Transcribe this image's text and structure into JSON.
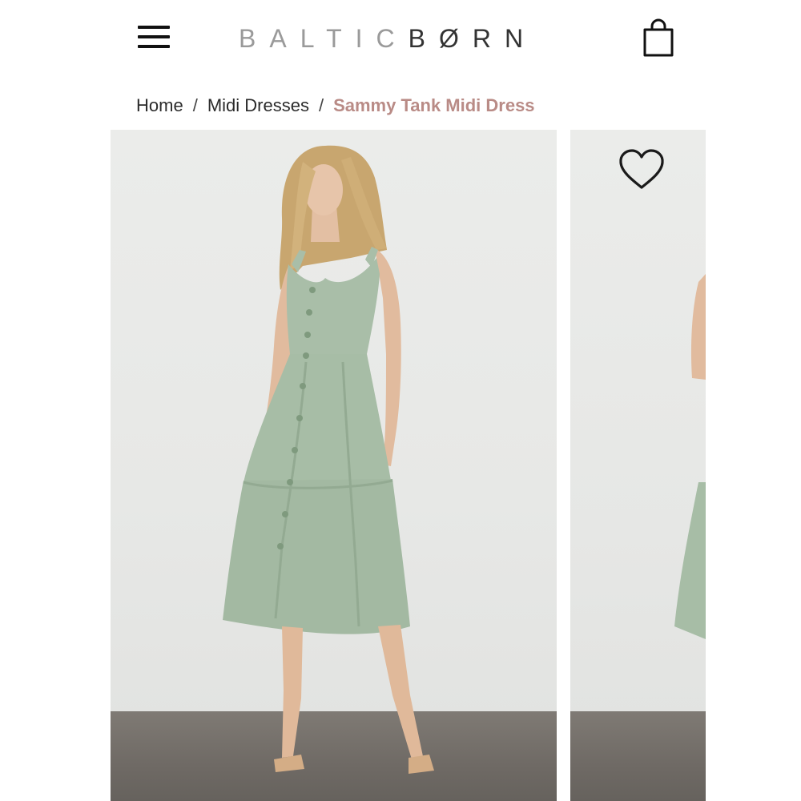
{
  "header": {
    "logo_light": "BALTIC",
    "logo_dark": "BØRN",
    "menu_icon": "hamburger-menu-icon",
    "bag_icon": "shopping-bag-icon"
  },
  "breadcrumb": {
    "items": [
      {
        "label": "Home"
      },
      {
        "label": "Midi Dresses"
      },
      {
        "label": "Sammy Tank Midi Dress"
      }
    ],
    "separator": "/"
  },
  "gallery": {
    "favorite_icon": "heart-outline-icon"
  },
  "colors": {
    "accent_breadcrumb": "#b98b86",
    "dress_sage": "#a9bea8",
    "text_dark": "#2b2b2b"
  }
}
